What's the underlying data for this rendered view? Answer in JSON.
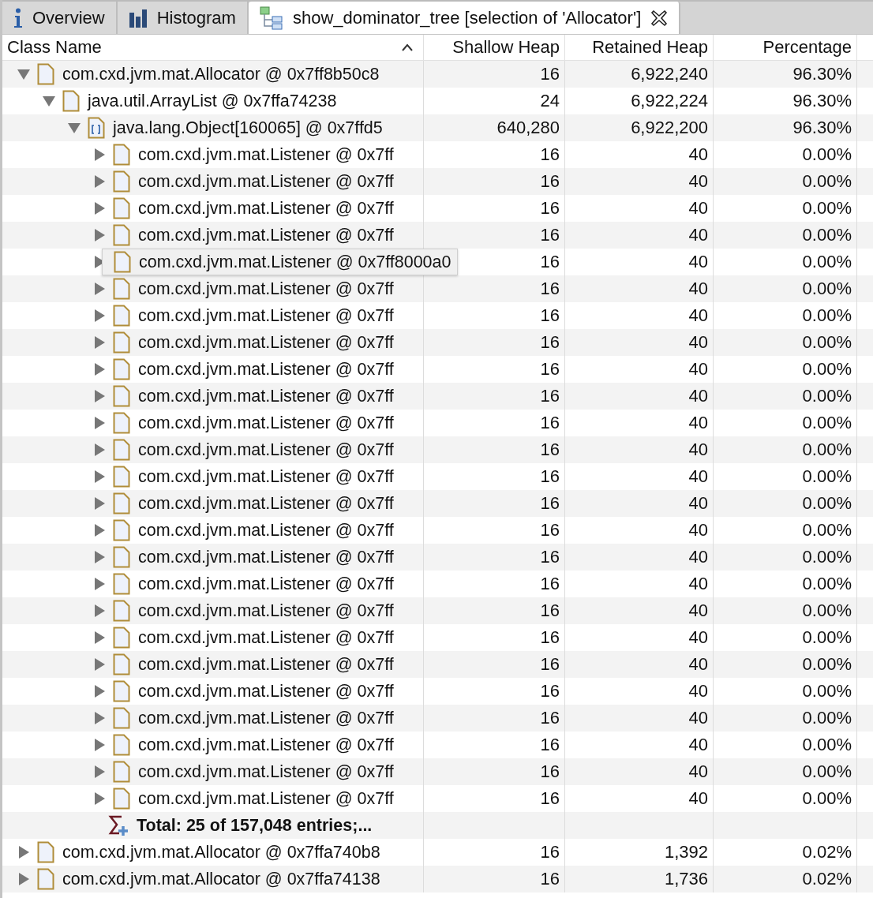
{
  "tabs": [
    {
      "label": "Overview",
      "selected": false
    },
    {
      "label": "Histogram",
      "selected": false
    },
    {
      "label": "show_dominator_tree [selection of 'Allocator']",
      "selected": true,
      "closable": true
    }
  ],
  "table": {
    "columns": [
      {
        "label": "Class Name",
        "sorted": true
      },
      {
        "label": "Shallow Heap",
        "sorted": false
      },
      {
        "label": "Retained Heap",
        "sorted": false
      },
      {
        "label": "Percentage",
        "sorted": false
      }
    ],
    "rows": [
      {
        "kind": "object",
        "name": "com.cxd.jvm.mat.Allocator @ 0x7ff8b50c8",
        "shallow": "16",
        "retained": "6,922,240",
        "percentage": "96.30%",
        "expanded": true,
        "children": [
          {
            "kind": "object",
            "name": "java.util.ArrayList @ 0x7ffa74238",
            "shallow": "24",
            "retained": "6,922,224",
            "percentage": "96.30%",
            "expanded": true,
            "children": [
              {
                "kind": "array",
                "name": "java.lang.Object[160065] @ 0x7ffd5",
                "shallow": "640,280",
                "retained": "6,922,200",
                "percentage": "96.30%",
                "expanded": true,
                "children": [
                  {
                    "kind": "object",
                    "name": "com.cxd.jvm.mat.Listener @ 0x7ff",
                    "shallow": "16",
                    "retained": "40",
                    "percentage": "0.00%",
                    "expanded": false
                  },
                  {
                    "kind": "object",
                    "name": "com.cxd.jvm.mat.Listener @ 0x7ff",
                    "shallow": "16",
                    "retained": "40",
                    "percentage": "0.00%",
                    "expanded": false
                  },
                  {
                    "kind": "object",
                    "name": "com.cxd.jvm.mat.Listener @ 0x7ff",
                    "shallow": "16",
                    "retained": "40",
                    "percentage": "0.00%",
                    "expanded": false
                  },
                  {
                    "kind": "object",
                    "name": "com.cxd.jvm.mat.Listener @ 0x7ff",
                    "shallow": "16",
                    "retained": "40",
                    "percentage": "0.00%",
                    "expanded": false
                  },
                  {
                    "kind": "object",
                    "tooltip": "com.cxd.jvm.mat.Listener @ 0x7ff8000a0",
                    "shallow": "16",
                    "retained": "40",
                    "percentage": "0.00%",
                    "expanded": false
                  },
                  {
                    "kind": "object",
                    "name": "com.cxd.jvm.mat.Listener @ 0x7ff",
                    "shallow": "16",
                    "retained": "40",
                    "percentage": "0.00%",
                    "expanded": false
                  },
                  {
                    "kind": "object",
                    "name": "com.cxd.jvm.mat.Listener @ 0x7ff",
                    "shallow": "16",
                    "retained": "40",
                    "percentage": "0.00%",
                    "expanded": false
                  },
                  {
                    "kind": "object",
                    "name": "com.cxd.jvm.mat.Listener @ 0x7ff",
                    "shallow": "16",
                    "retained": "40",
                    "percentage": "0.00%",
                    "expanded": false
                  },
                  {
                    "kind": "object",
                    "name": "com.cxd.jvm.mat.Listener @ 0x7ff",
                    "shallow": "16",
                    "retained": "40",
                    "percentage": "0.00%",
                    "expanded": false
                  },
                  {
                    "kind": "object",
                    "name": "com.cxd.jvm.mat.Listener @ 0x7ff",
                    "shallow": "16",
                    "retained": "40",
                    "percentage": "0.00%",
                    "expanded": false
                  },
                  {
                    "kind": "object",
                    "name": "com.cxd.jvm.mat.Listener @ 0x7ff",
                    "shallow": "16",
                    "retained": "40",
                    "percentage": "0.00%",
                    "expanded": false
                  },
                  {
                    "kind": "object",
                    "name": "com.cxd.jvm.mat.Listener @ 0x7ff",
                    "shallow": "16",
                    "retained": "40",
                    "percentage": "0.00%",
                    "expanded": false
                  },
                  {
                    "kind": "object",
                    "name": "com.cxd.jvm.mat.Listener @ 0x7ff",
                    "shallow": "16",
                    "retained": "40",
                    "percentage": "0.00%",
                    "expanded": false
                  },
                  {
                    "kind": "object",
                    "name": "com.cxd.jvm.mat.Listener @ 0x7ff",
                    "shallow": "16",
                    "retained": "40",
                    "percentage": "0.00%",
                    "expanded": false
                  },
                  {
                    "kind": "object",
                    "name": "com.cxd.jvm.mat.Listener @ 0x7ff",
                    "shallow": "16",
                    "retained": "40",
                    "percentage": "0.00%",
                    "expanded": false
                  },
                  {
                    "kind": "object",
                    "name": "com.cxd.jvm.mat.Listener @ 0x7ff",
                    "shallow": "16",
                    "retained": "40",
                    "percentage": "0.00%",
                    "expanded": false
                  },
                  {
                    "kind": "object",
                    "name": "com.cxd.jvm.mat.Listener @ 0x7ff",
                    "shallow": "16",
                    "retained": "40",
                    "percentage": "0.00%",
                    "expanded": false
                  },
                  {
                    "kind": "object",
                    "name": "com.cxd.jvm.mat.Listener @ 0x7ff",
                    "shallow": "16",
                    "retained": "40",
                    "percentage": "0.00%",
                    "expanded": false
                  },
                  {
                    "kind": "object",
                    "name": "com.cxd.jvm.mat.Listener @ 0x7ff",
                    "shallow": "16",
                    "retained": "40",
                    "percentage": "0.00%",
                    "expanded": false
                  },
                  {
                    "kind": "object",
                    "name": "com.cxd.jvm.mat.Listener @ 0x7ff",
                    "shallow": "16",
                    "retained": "40",
                    "percentage": "0.00%",
                    "expanded": false
                  },
                  {
                    "kind": "object",
                    "name": "com.cxd.jvm.mat.Listener @ 0x7ff",
                    "shallow": "16",
                    "retained": "40",
                    "percentage": "0.00%",
                    "expanded": false
                  },
                  {
                    "kind": "object",
                    "name": "com.cxd.jvm.mat.Listener @ 0x7ff",
                    "shallow": "16",
                    "retained": "40",
                    "percentage": "0.00%",
                    "expanded": false
                  },
                  {
                    "kind": "object",
                    "name": "com.cxd.jvm.mat.Listener @ 0x7ff",
                    "shallow": "16",
                    "retained": "40",
                    "percentage": "0.00%",
                    "expanded": false
                  },
                  {
                    "kind": "object",
                    "name": "com.cxd.jvm.mat.Listener @ 0x7ff",
                    "shallow": "16",
                    "retained": "40",
                    "percentage": "0.00%",
                    "expanded": false
                  },
                  {
                    "kind": "object",
                    "name": "com.cxd.jvm.mat.Listener @ 0x7ff",
                    "shallow": "16",
                    "retained": "40",
                    "percentage": "0.00%",
                    "expanded": false
                  },
                  {
                    "kind": "total",
                    "name": "Total: 25 of 157,048 entries;..."
                  }
                ]
              }
            ]
          }
        ]
      },
      {
        "kind": "object",
        "name": "com.cxd.jvm.mat.Allocator @ 0x7ffa740b8",
        "shallow": "16",
        "retained": "1,392",
        "percentage": "0.02%",
        "expanded": false
      },
      {
        "kind": "object",
        "name": "com.cxd.jvm.mat.Allocator @ 0x7ffa74138",
        "shallow": "16",
        "retained": "1,736",
        "percentage": "0.02%",
        "expanded": false
      }
    ]
  }
}
